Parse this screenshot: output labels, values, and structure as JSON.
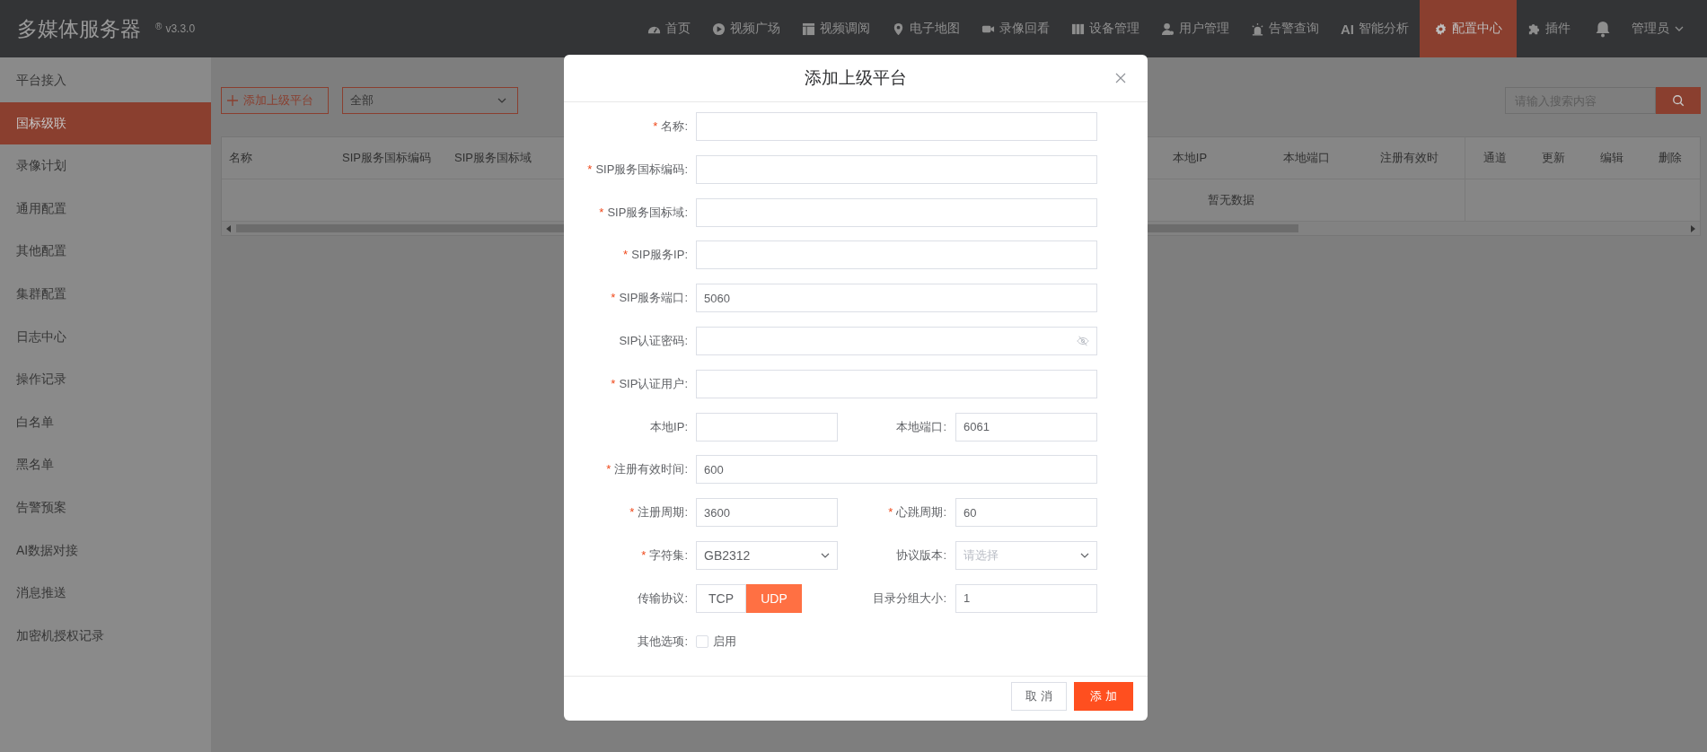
{
  "header": {
    "title": "多媒体服务器",
    "version_mark": "®",
    "version": "v3.3.0",
    "nav": [
      {
        "label": "首页",
        "selected": false
      },
      {
        "label": "视频广场",
        "selected": false
      },
      {
        "label": "视频调阅",
        "selected": false
      },
      {
        "label": "电子地图",
        "selected": false
      },
      {
        "label": "录像回看",
        "selected": false
      },
      {
        "label": "设备管理",
        "selected": false
      },
      {
        "label": "用户管理",
        "selected": false
      },
      {
        "label": "告警查询",
        "selected": false
      },
      {
        "icon_text": "AI",
        "label": "智能分析",
        "selected": false
      },
      {
        "label": "配置中心",
        "selected": true
      },
      {
        "label": "插件",
        "selected": false
      }
    ],
    "user": "管理员"
  },
  "sidebar": {
    "items": [
      {
        "label": "平台接入",
        "selected": false
      },
      {
        "label": "国标级联",
        "selected": true
      },
      {
        "label": "录像计划",
        "selected": false
      },
      {
        "label": "通用配置",
        "selected": false
      },
      {
        "label": "其他配置",
        "selected": false
      },
      {
        "label": "集群配置",
        "selected": false
      },
      {
        "label": "日志中心",
        "selected": false
      },
      {
        "label": "操作记录",
        "selected": false
      },
      {
        "label": "白名单",
        "selected": false
      },
      {
        "label": "黑名单",
        "selected": false
      },
      {
        "label": "告警预案",
        "selected": false
      },
      {
        "label": "AI数据对接",
        "selected": false
      },
      {
        "label": "消息推送",
        "selected": false
      },
      {
        "label": "加密机授权记录",
        "selected": false
      }
    ]
  },
  "toolbar": {
    "add_button": "添加上级平台",
    "filter": {
      "value": "全部"
    },
    "search": {
      "placeholder": "请输入搜索内容"
    }
  },
  "table": {
    "columns": [
      "名称",
      "SIP服务国标编码",
      "SIP服务国标域"
    ],
    "right_columns": [
      "本地IP",
      "本地端口",
      "注册有效时"
    ],
    "fixed_columns": [
      "通道",
      "更新",
      "编辑",
      "删除"
    ],
    "empty_text": "暂无数据"
  },
  "dialog": {
    "title": "添加上级平台",
    "required_mark": "*",
    "rows": [
      [
        {
          "label": "名称:",
          "required": true,
          "kind": "text"
        }
      ],
      [
        {
          "label": "SIP服务国标编码:",
          "required": true,
          "kind": "text"
        }
      ],
      [
        {
          "label": "SIP服务国标域:",
          "required": true,
          "kind": "text"
        }
      ],
      [
        {
          "label": "SIP服务IP:",
          "required": true,
          "kind": "text"
        }
      ],
      [
        {
          "label": "SIP服务端口:",
          "required": true,
          "kind": "text",
          "value": "5060"
        }
      ],
      [
        {
          "label": "SIP认证密码:",
          "required": false,
          "kind": "password"
        }
      ],
      [
        {
          "label": "SIP认证用户:",
          "required": true,
          "kind": "text"
        }
      ],
      [
        {
          "label": "本地IP:",
          "required": false,
          "kind": "text"
        },
        {
          "label": "本地端口:",
          "required": false,
          "kind": "text",
          "value": "6061"
        }
      ],
      [
        {
          "label": "注册有效时间:",
          "required": true,
          "kind": "text",
          "value": "600"
        }
      ],
      [
        {
          "label": "注册周期:",
          "required": true,
          "kind": "text",
          "value": "3600"
        },
        {
          "label": "心跳周期:",
          "required": true,
          "kind": "text",
          "value": "60"
        }
      ],
      [
        {
          "label": "字符集:",
          "required": true,
          "kind": "select",
          "value": "GB2312"
        },
        {
          "label": "协议版本:",
          "required": false,
          "kind": "select",
          "placeholder": "请选择"
        }
      ],
      [
        {
          "label": "传输协议:",
          "required": false,
          "kind": "segmented",
          "options": [
            {
              "label": "TCP",
              "selected": false
            },
            {
              "label": "UDP",
              "selected": true
            }
          ]
        },
        {
          "label": "目录分组大小:",
          "required": false,
          "kind": "text",
          "value": "1"
        }
      ],
      [
        {
          "label": "其他选项:",
          "required": false,
          "kind": "checkbox",
          "option_label": "启用",
          "checked": false
        }
      ]
    ],
    "buttons": [
      {
        "label": "取 消",
        "kind": "default"
      },
      {
        "label": "添 加",
        "kind": "primary"
      }
    ]
  }
}
